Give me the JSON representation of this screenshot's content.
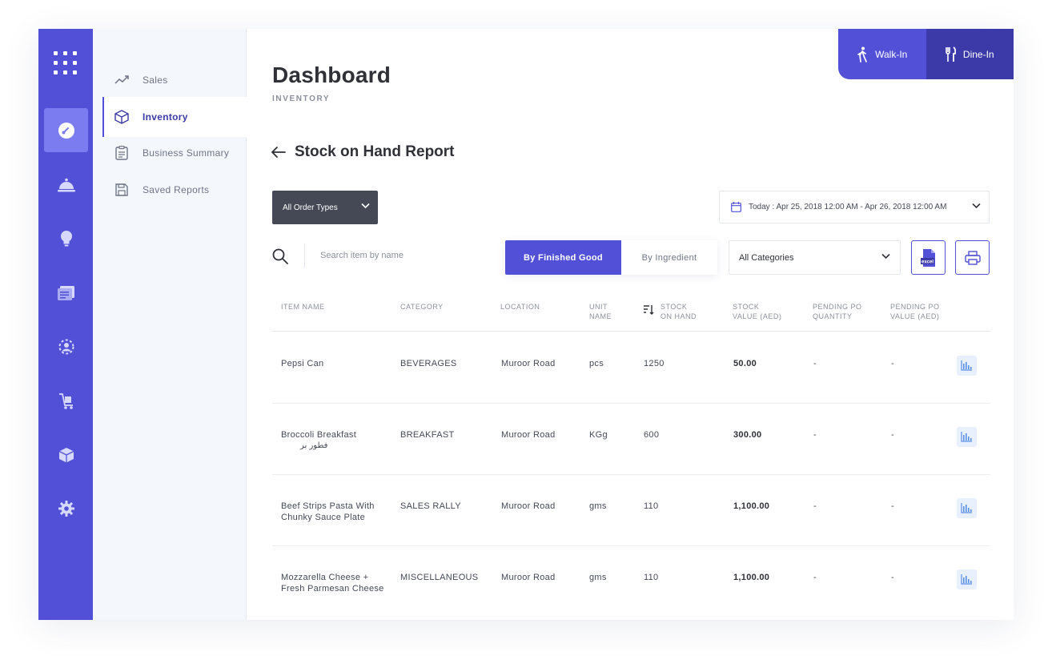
{
  "nav": {
    "rail_icons": [
      "apps-grid-icon",
      "dashboard-icon",
      "cloche-icon",
      "lightbulb-icon",
      "notes-icon",
      "user-settings-icon",
      "cart-icon",
      "box-icon",
      "gear-icon"
    ],
    "items": [
      {
        "label": "Sales",
        "icon": "trend-icon"
      },
      {
        "label": "Inventory",
        "icon": "box-icon"
      },
      {
        "label": "Business Summary",
        "icon": "clipboard-icon"
      },
      {
        "label": "Saved Reports",
        "icon": "floppy-icon"
      }
    ]
  },
  "header": {
    "title": "Dashboard",
    "subtitle": "INVENTORY",
    "walk_in": "Walk-In",
    "dine_in": "Dine-In"
  },
  "report": {
    "title": "Stock on Hand Report",
    "order_types": "All Order Types",
    "date_range": "Today : Apr 25, 2018 12:00 AM - Apr 26, 2018 12:00 AM",
    "search_placeholder": "Search item by name",
    "tab_finished": "By Finished Good",
    "tab_ingredient": "By Ingredient",
    "categories": "All Categories",
    "excel_label": "excel"
  },
  "table": {
    "headers": {
      "item_name": "ITEM NAME",
      "category": "CATEGORY",
      "location": "LOCATION",
      "unit_1": "UNIT",
      "unit_2": "NAME",
      "stock_1": "STOCK",
      "stock_2": "ON HAND",
      "value_1": "STOCK",
      "value_2": "VALUE (AED)",
      "pq_1": "PENDING PO",
      "pq_2": "QUANTITY",
      "pv_1": "PENDING PO",
      "pv_2": "VALUE (AED)"
    },
    "rows": [
      {
        "name": "Pepsi Can",
        "name_ar": "",
        "category": "BEVERAGES",
        "location": "Muroor Road",
        "unit": "pcs",
        "stock": "1250",
        "value": "50.00",
        "pending_qty": "-",
        "pending_value": "-"
      },
      {
        "name": "Broccoli Breakfast",
        "name_ar": "فطور بر",
        "category": "BREAKFAST",
        "location": "Muroor Road",
        "unit": "KGg",
        "stock": "600",
        "value": "300.00",
        "pending_qty": "-",
        "pending_value": "-"
      },
      {
        "name": "Beef Strips Pasta With Chunky Sauce Plate",
        "name_ar": "",
        "category": "SALES RALLY",
        "location": "Muroor Road",
        "unit": "gms",
        "stock": "110",
        "value": "1,100.00",
        "pending_qty": "-",
        "pending_value": "-"
      },
      {
        "name": "Mozzarella Cheese + Fresh Parmesan Cheese",
        "name_ar": "",
        "category": "MISCELLANEOUS",
        "location": "Muroor Road",
        "unit": "gms",
        "stock": "110",
        "value": "1,100.00",
        "pending_qty": "-",
        "pending_value": "-"
      }
    ]
  },
  "colors": {
    "accent": "#5150d6",
    "accent_dark": "#3c3aa8",
    "rail_active": "#7b7cf0",
    "select_dark": "#454955"
  }
}
